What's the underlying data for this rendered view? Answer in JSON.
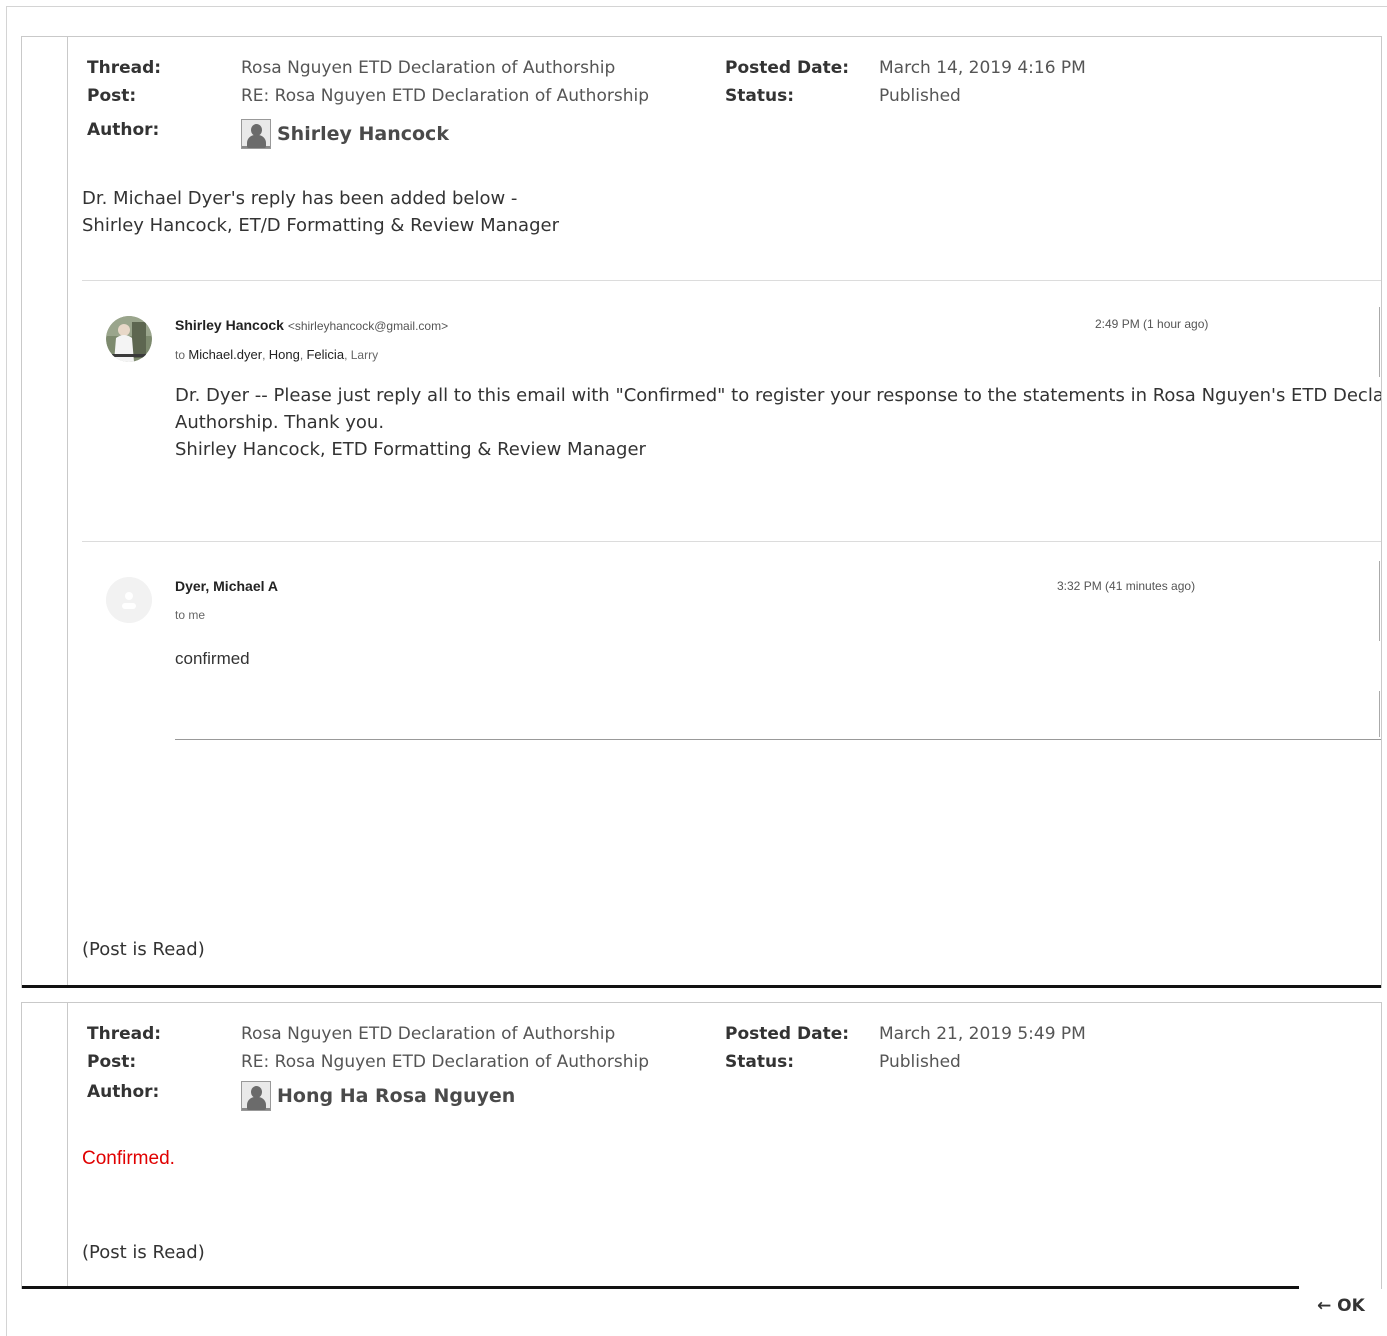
{
  "labels": {
    "thread": "Thread:",
    "post": "Post:",
    "author": "Author:",
    "posted_date": "Posted Date:",
    "status": "Status:"
  },
  "posts": [
    {
      "thread": "Rosa Nguyen ETD Declaration of Authorship",
      "post": "RE: Rosa Nguyen ETD Declaration of Authorship",
      "author": "Shirley Hancock",
      "posted_date": "March 14, 2019 4:16 PM",
      "status": "Published",
      "body_lines": [
        "Dr. Michael Dyer's reply has been added below -",
        "Shirley Hancock, ET/D Formatting & Review Manager"
      ],
      "emails": [
        {
          "sender": "Shirley Hancock",
          "sender_email": "<shirleyhancock@gmail.com>",
          "to_prefix": "to",
          "recipients": [
            "Michael.dyer",
            "Hong",
            "Felicia",
            "Larry"
          ],
          "time": "2:49 PM (1 hour ago)",
          "body_lines": [
            "Dr. Dyer -- Please just reply all to this email with \"Confirmed\" to register your response to the statements in Rosa Nguyen's ETD Declaration of",
            "Authorship.  Thank you.",
            "Shirley Hancock, ETD Formatting & Review Manager"
          ]
        },
        {
          "sender": "Dyer, Michael A",
          "to_line": "to me",
          "time": "3:32 PM (41 minutes ago)",
          "body": "confirmed"
        }
      ],
      "read_status": "(Post is Read)"
    },
    {
      "thread": "Rosa Nguyen ETD Declaration of Authorship",
      "post": "RE: Rosa Nguyen ETD Declaration of Authorship",
      "author": "Hong Ha Rosa Nguyen",
      "posted_date": "March 21, 2019 5:49 PM",
      "status": "Published",
      "body": "Confirmed.",
      "body_color": "#e00000",
      "read_status": "(Post is Read)"
    }
  ],
  "footer": {
    "ok_label": "← OK"
  }
}
